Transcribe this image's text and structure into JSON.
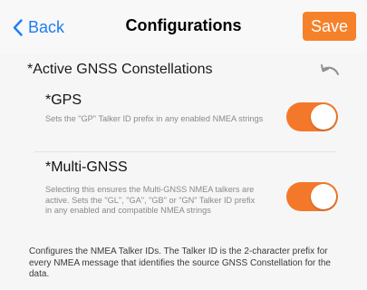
{
  "navbar": {
    "back_label": "Back",
    "title": "Configurations",
    "save_label": "Save"
  },
  "section": {
    "title": "*Active GNSS Constellations",
    "undo_icon": "undo-icon"
  },
  "rows": [
    {
      "title": "*GPS",
      "description": "Sets the \"GP\" Talker ID prefix in any enabled NMEA strings",
      "enabled": true
    },
    {
      "title": "*Multi-GNSS",
      "description": "Selecting this ensures the Multi-GNSS NMEA talkers are active.  Sets the \"GL\", \"GA\", \"GB\" or \"GN\" Talker ID prefix in any enabled and compatible NMEA strings",
      "enabled": true
    }
  ],
  "footer": {
    "note": "Configures the NMEA Talker IDs. The Talker ID is the 2-character prefix for every NMEA message that identifies the source GNSS Constellation for the data."
  },
  "colors": {
    "accent_blue": "#1f7ef1",
    "accent_orange": "#f5822a"
  }
}
